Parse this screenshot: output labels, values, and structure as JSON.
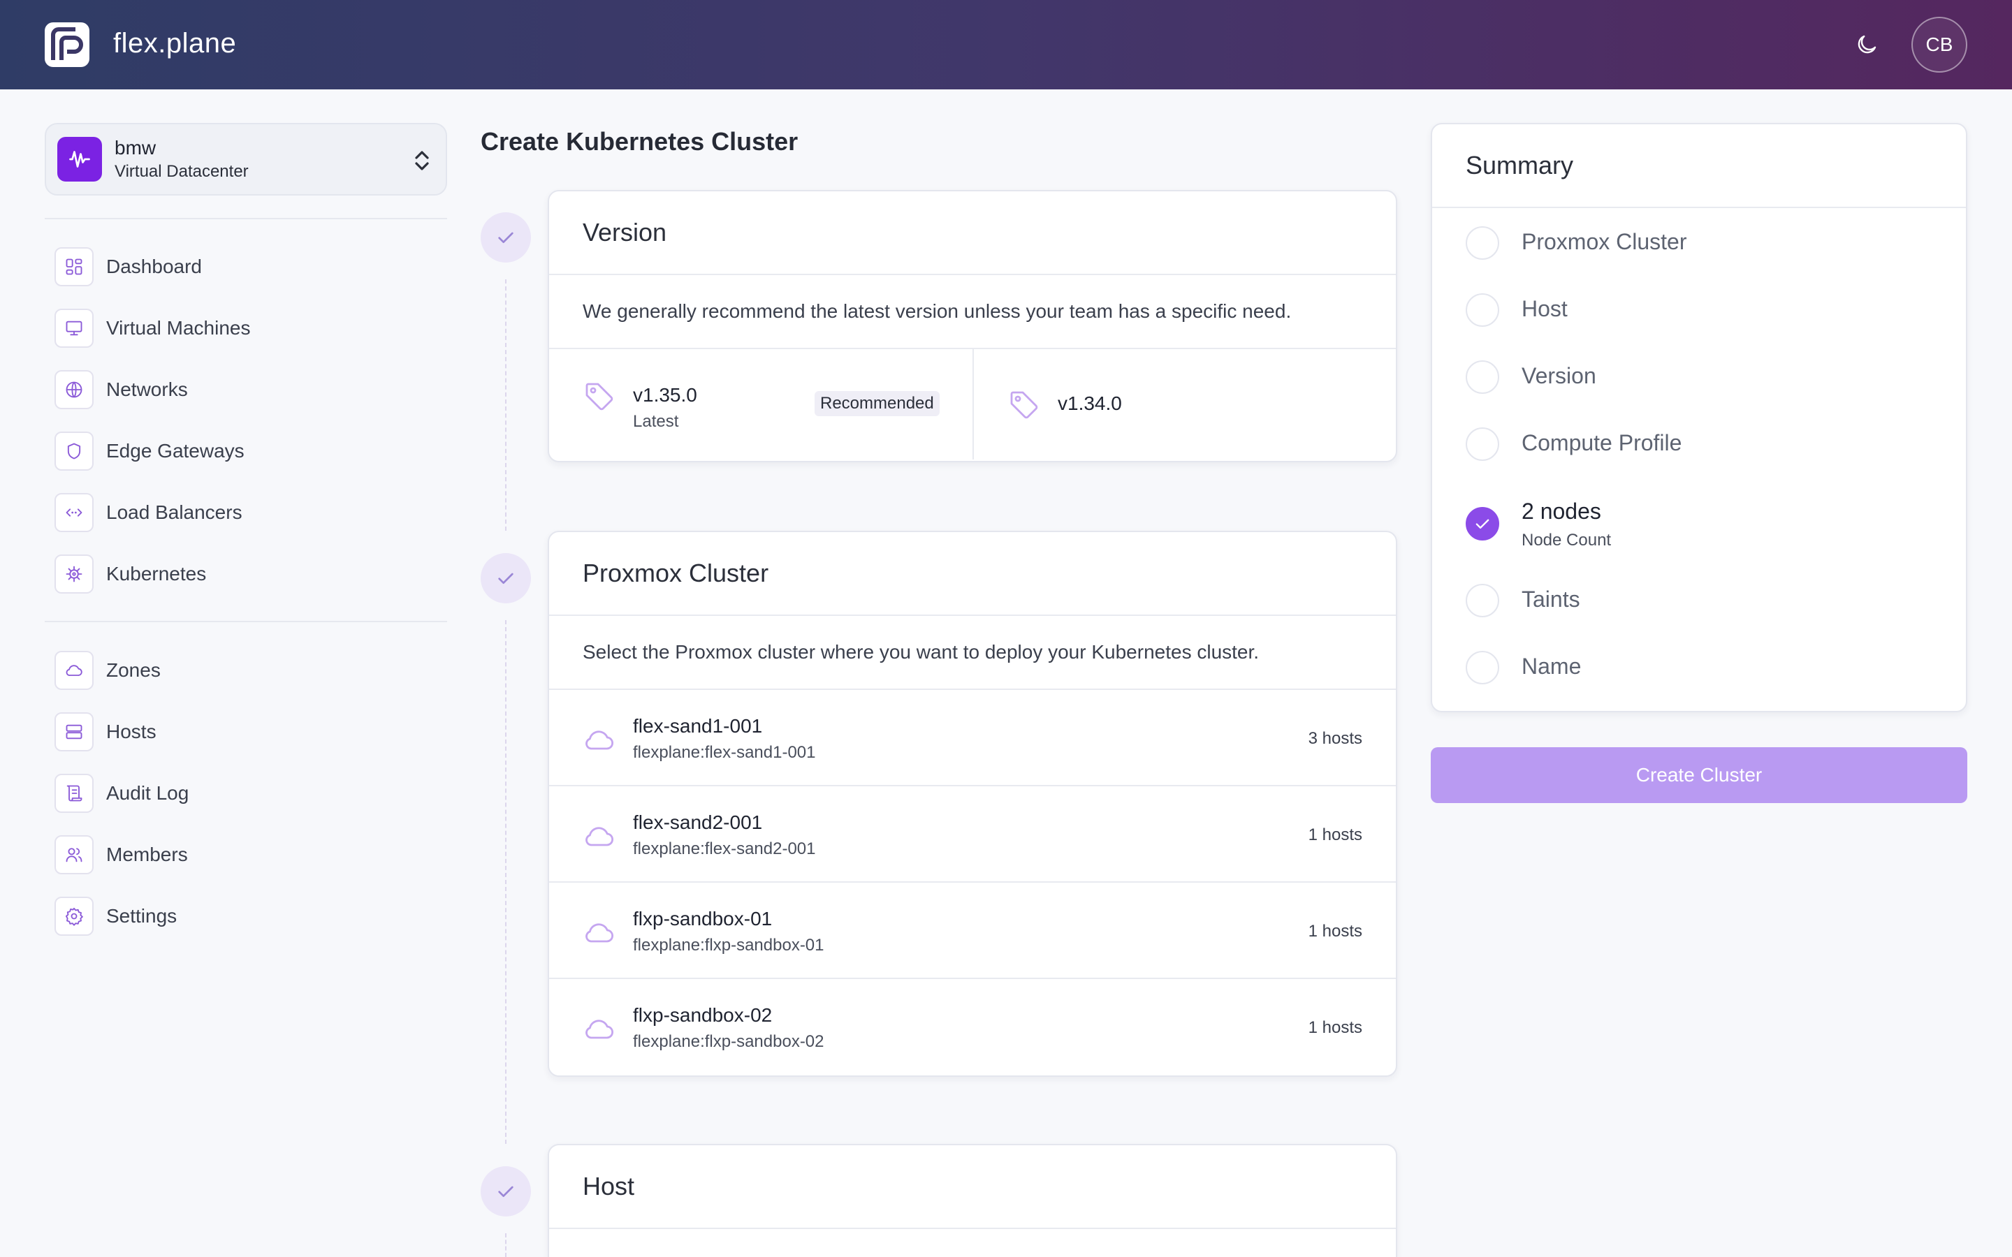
{
  "header": {
    "brand": "flex.plane",
    "avatar_initials": "CB",
    "icons": {
      "logo": "flexplane-logo-icon",
      "theme": "moon-icon"
    }
  },
  "sidebar": {
    "org": {
      "name": "bmw",
      "type": "Virtual Datacenter",
      "icon": "waveform-icon"
    },
    "nav_primary": [
      {
        "label": "Dashboard",
        "icon": "dashboard-icon"
      },
      {
        "label": "Virtual Machines",
        "icon": "monitor-icon"
      },
      {
        "label": "Networks",
        "icon": "globe-icon"
      },
      {
        "label": "Edge Gateways",
        "icon": "shield-icon"
      },
      {
        "label": "Load Balancers",
        "icon": "code-brackets-icon"
      },
      {
        "label": "Kubernetes",
        "icon": "helm-icon"
      }
    ],
    "nav_secondary": [
      {
        "label": "Zones",
        "icon": "cloud-icon"
      },
      {
        "label": "Hosts",
        "icon": "server-icon"
      },
      {
        "label": "Audit Log",
        "icon": "scroll-icon"
      },
      {
        "label": "Members",
        "icon": "users-icon"
      },
      {
        "label": "Settings",
        "icon": "gear-icon"
      }
    ]
  },
  "main": {
    "title": "Create Kubernetes Cluster",
    "version_step": {
      "title": "Version",
      "description": "We generally recommend the latest version unless your team has a specific need.",
      "options": [
        {
          "name": "v1.35.0",
          "sub": "Latest",
          "badge": "Recommended"
        },
        {
          "name": "v1.34.0",
          "sub": "",
          "badge": ""
        }
      ]
    },
    "cluster_step": {
      "title": "Proxmox Cluster",
      "description": "Select the Proxmox cluster where you want to deploy your Kubernetes cluster.",
      "clusters": [
        {
          "name": "flex-sand1-001",
          "id": "flexplane:flex-sand1-001",
          "hosts": "3 hosts"
        },
        {
          "name": "flex-sand2-001",
          "id": "flexplane:flex-sand2-001",
          "hosts": "1 hosts"
        },
        {
          "name": "flxp-sandbox-01",
          "id": "flexplane:flxp-sandbox-01",
          "hosts": "1 hosts"
        },
        {
          "name": "flxp-sandbox-02",
          "id": "flexplane:flxp-sandbox-02",
          "hosts": "1 hosts"
        }
      ]
    },
    "host_step": {
      "title": "Host"
    }
  },
  "summary": {
    "title": "Summary",
    "items": [
      {
        "label": "Proxmox Cluster",
        "done": false
      },
      {
        "label": "Host",
        "done": false
      },
      {
        "label": "Version",
        "done": false
      },
      {
        "label": "Compute Profile",
        "done": false
      },
      {
        "label": "2 nodes",
        "sub": "Node Count",
        "done": true
      },
      {
        "label": "Taints",
        "done": false
      },
      {
        "label": "Name",
        "done": false
      }
    ],
    "create_button": "Create Cluster"
  },
  "colors": {
    "accent": "#8b4be8",
    "accent_disabled": "#b99af2",
    "brand_purple": "#7b22e3",
    "header_gradient_start": "#2f3c66",
    "header_gradient_end": "#55275f"
  }
}
